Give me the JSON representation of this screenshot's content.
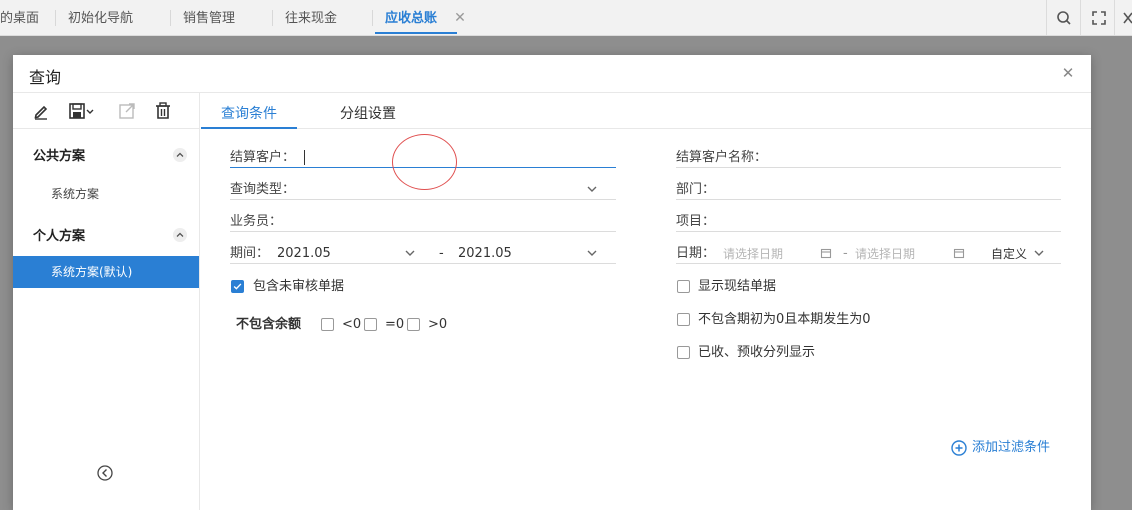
{
  "top_tabs": [
    {
      "label": "的桌面"
    },
    {
      "label": "初始化导航"
    },
    {
      "label": "销售管理"
    },
    {
      "label": "往来现金"
    },
    {
      "label": "应收总账"
    }
  ],
  "top_icons": [
    "search-icon",
    "fullscreen-icon",
    "close-icon"
  ],
  "dialog": {
    "title": "查询"
  },
  "left_panel": {
    "toolbar_icons": [
      "edit-icon",
      "save-icon",
      "export-icon",
      "delete-icon"
    ],
    "groups": [
      {
        "title": "公共方案",
        "items": [
          "系统方案"
        ]
      },
      {
        "title": "个人方案",
        "items": [
          "系统方案(默认)"
        ]
      }
    ]
  },
  "right_tabs": [
    "查询条件",
    "分组设置"
  ],
  "form": {
    "settle_customer_label": "结算客户：",
    "query_type_label": "查询类型：",
    "salesperson_label": "业务员：",
    "period_label": "期间：",
    "period_from": "2021.05",
    "period_dash": "-",
    "period_to": "2021.05",
    "include_unaudited": "包含未审核单据",
    "exclude_balance_label": "不包含余额",
    "balance_options": [
      "<0",
      "=0",
      ">0"
    ],
    "settle_customer_name_label": "结算客户名称：",
    "department_label": "部门：",
    "project_label": "项目：",
    "date_label": "日期：",
    "date_from_placeholder": "请选择日期",
    "date_dash": "-",
    "date_to_placeholder": "请选择日期",
    "date_mode": "自定义",
    "show_cash_settlement": "显示现结单据",
    "exclude_zero": "不包含期初为0且本期发生为0",
    "show_received_separately": "已收、预收分列显示",
    "add_filter": "添加过滤条件"
  },
  "colors": {
    "accent": "#2a7fd4",
    "backdrop": "#8e8e8e"
  }
}
